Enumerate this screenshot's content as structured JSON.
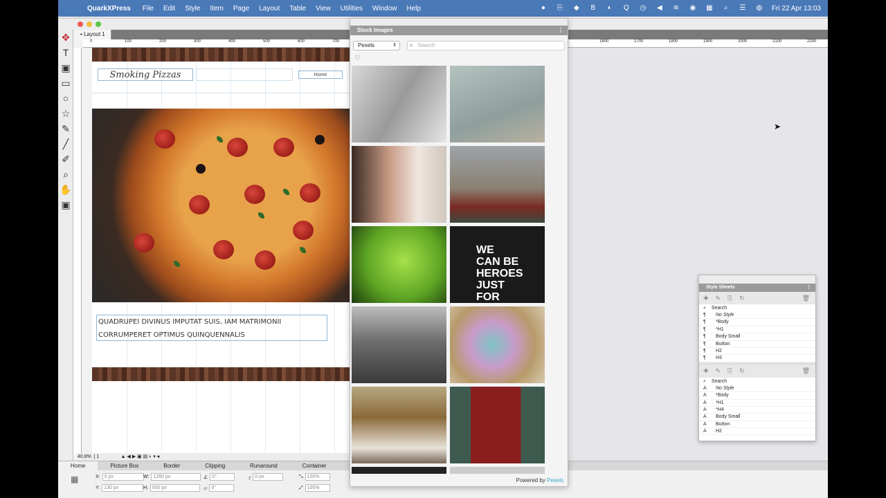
{
  "menubar": {
    "app": "QuarkXPress",
    "items": [
      "File",
      "Edit",
      "Style",
      "Item",
      "Page",
      "Layout",
      "Table",
      "View",
      "Utilities",
      "Window",
      "Help"
    ],
    "datetime": "Fri 22 Apr  13:03"
  },
  "window": {
    "tab": "Layout 1"
  },
  "ruler": {
    "ticks": [
      "0",
      "100",
      "200",
      "300",
      "400",
      "500",
      "600",
      "700",
      "800",
      "1600",
      "1700",
      "1800",
      "1900",
      "2000",
      "2100",
      "2200"
    ]
  },
  "page": {
    "logo": "Smoking Pizzas",
    "nav_home": "Home",
    "body_text": "QUADRUPEI DIVINUS IMPUTAT SUIS, IAM MATRIMONII CORRUMPERET OPTIMUS QUINQUENNALIS"
  },
  "statusbar": {
    "zoom": "40.8%",
    "page": "1"
  },
  "measurements": {
    "tabs": [
      "Home",
      "Picture Box",
      "Border",
      "Clipping",
      "Runaround",
      "Container"
    ],
    "x_label": "X:",
    "x_value": "0 px",
    "y_label": "Y:",
    "y_value": "130 px",
    "w_label": "W:",
    "w_value": "1280 px",
    "h_label": "H:",
    "h_value": "600 px",
    "angle1": "0°",
    "angle2": "0°",
    "offset": "0 px",
    "scale1": "100%",
    "scale2": "100%"
  },
  "stock_images": {
    "title": "Stock Images",
    "source": "Pexels",
    "search_placeholder": "Search",
    "powered_prefix": "Powered by ",
    "powered_brand": "Pexels",
    "sign_text": [
      "WE",
      "CAN BE",
      "HEROES",
      "JUST",
      "FOR"
    ]
  },
  "style_sheets": {
    "title": "Style Sheets",
    "search_label": "Search",
    "paragraph_styles": [
      "No Style",
      "*Body",
      "*H1",
      "Body Small",
      "Button",
      "H2",
      "H3"
    ],
    "character_styles": [
      "No Style",
      "*Body",
      "*H1",
      "*H4",
      "Body Small",
      "Button",
      "H2"
    ]
  },
  "colors": {
    "menubar": "#4a79b8",
    "accent": "#3aa5c9",
    "wood": "#5a3424"
  }
}
